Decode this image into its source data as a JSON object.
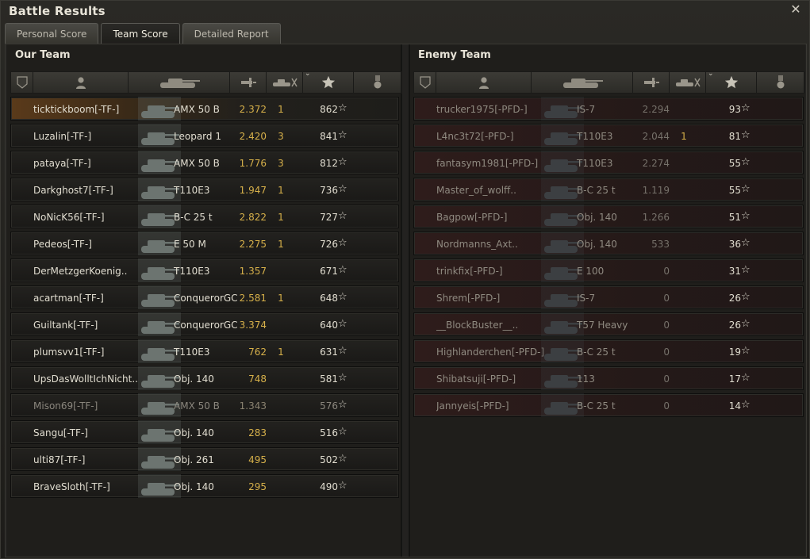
{
  "window": {
    "title": "Battle Results",
    "close_glyph": "✕"
  },
  "tabs": [
    {
      "label": "Personal Score",
      "active": false
    },
    {
      "label": "Team Score",
      "active": true
    },
    {
      "label": "Detailed Report",
      "active": false
    }
  ],
  "our_team": {
    "title": "Our Team",
    "rows": [
      {
        "player": "ticktickboom[-TF-]",
        "vehicle": "AMX 50 B",
        "damage": "2.372",
        "kills": "1",
        "xp": "862",
        "top": true
      },
      {
        "player": "Luzalin[-TF-]",
        "vehicle": "Leopard 1",
        "damage": "2.420",
        "kills": "3",
        "xp": "841"
      },
      {
        "player": "pataya[-TF-]",
        "vehicle": "AMX 50 B",
        "damage": "1.776",
        "kills": "3",
        "xp": "812"
      },
      {
        "player": "Darkghost7[-TF-]",
        "vehicle": "T110E3",
        "damage": "1.947",
        "kills": "1",
        "xp": "736"
      },
      {
        "player": "NoNicK56[-TF-]",
        "vehicle": "B-C 25 t",
        "damage": "2.822",
        "kills": "1",
        "xp": "727"
      },
      {
        "player": "Pedeos[-TF-]",
        "vehicle": "E 50 M",
        "damage": "2.275",
        "kills": "1",
        "xp": "726"
      },
      {
        "player": "DerMetzgerKoenig..",
        "vehicle": "T110E3",
        "damage": "1.357",
        "kills": "",
        "xp": "671"
      },
      {
        "player": "acartman[-TF-]",
        "vehicle": "ConquerorGC",
        "damage": "2.581",
        "kills": "1",
        "xp": "648"
      },
      {
        "player": "Guiltank[-TF-]",
        "vehicle": "ConquerorGC",
        "damage": "3.374",
        "kills": "",
        "xp": "640"
      },
      {
        "player": "plumsvv1[-TF-]",
        "vehicle": "T110E3",
        "damage": "762",
        "kills": "1",
        "xp": "631"
      },
      {
        "player": "UpsDasWolltIchNicht..",
        "vehicle": "Obj. 140",
        "damage": "748",
        "kills": "",
        "xp": "581"
      },
      {
        "player": "Mison69[-TF-]",
        "vehicle": "AMX 50 B",
        "damage": "1.343",
        "kills": "",
        "xp": "576",
        "dead": true
      },
      {
        "player": "Sangu[-TF-]",
        "vehicle": "Obj. 140",
        "damage": "283",
        "kills": "",
        "xp": "516"
      },
      {
        "player": "ulti87[-TF-]",
        "vehicle": "Obj. 261",
        "damage": "495",
        "kills": "",
        "xp": "502"
      },
      {
        "player": "BraveSloth[-TF-]",
        "vehicle": "Obj. 140",
        "damage": "295",
        "kills": "",
        "xp": "490"
      }
    ]
  },
  "enemy_team": {
    "title": "Enemy Team",
    "rows": [
      {
        "player": "trucker1975[-PFD-]",
        "vehicle": "IS-7",
        "damage": "2.294",
        "kills": "",
        "xp": "93"
      },
      {
        "player": "L4nc3t72[-PFD-]",
        "vehicle": "T110E3",
        "damage": "2.044",
        "kills": "1",
        "xp": "81"
      },
      {
        "player": "fantasym1981[-PFD-]",
        "vehicle": "T110E3",
        "damage": "2.274",
        "kills": "",
        "xp": "55"
      },
      {
        "player": "Master_of_wolff..",
        "vehicle": "B-C 25 t",
        "damage": "1.119",
        "kills": "",
        "xp": "55"
      },
      {
        "player": "Bagpow[-PFD-]",
        "vehicle": "Obj. 140",
        "damage": "1.266",
        "kills": "",
        "xp": "51"
      },
      {
        "player": "Nordmanns_Axt..",
        "vehicle": "Obj. 140",
        "damage": "533",
        "kills": "",
        "xp": "36"
      },
      {
        "player": "trinkfix[-PFD-]",
        "vehicle": "E 100",
        "damage": "0",
        "kills": "",
        "xp": "31"
      },
      {
        "player": "Shrem[-PFD-]",
        "vehicle": "IS-7",
        "damage": "0",
        "kills": "",
        "xp": "26"
      },
      {
        "player": "__BlockBuster__..",
        "vehicle": "T57 Heavy",
        "damage": "0",
        "kills": "",
        "xp": "26"
      },
      {
        "player": "Highlanderchen[-PFD-]",
        "vehicle": "B-C 25 t",
        "damage": "0",
        "kills": "",
        "xp": "19"
      },
      {
        "player": "Shibatsuji[-PFD-]",
        "vehicle": "113",
        "damage": "0",
        "kills": "",
        "xp": "17"
      },
      {
        "player": "Jannyeis[-PFD-]",
        "vehicle": "B-C 25 t",
        "damage": "0",
        "kills": "",
        "xp": "14"
      }
    ]
  },
  "columns": {
    "icons": [
      "squad-icon",
      "player-icon",
      "vehicle-icon",
      "damage-icon",
      "kills-icon",
      "experience-star-icon",
      "medal-icon"
    ],
    "sorted_column": "experience",
    "star_glyph": "☆"
  },
  "colors": {
    "damage_accent": "#d6b04a",
    "top_row": "#5a3a1a",
    "enemy_row": "#2e1c1b"
  }
}
